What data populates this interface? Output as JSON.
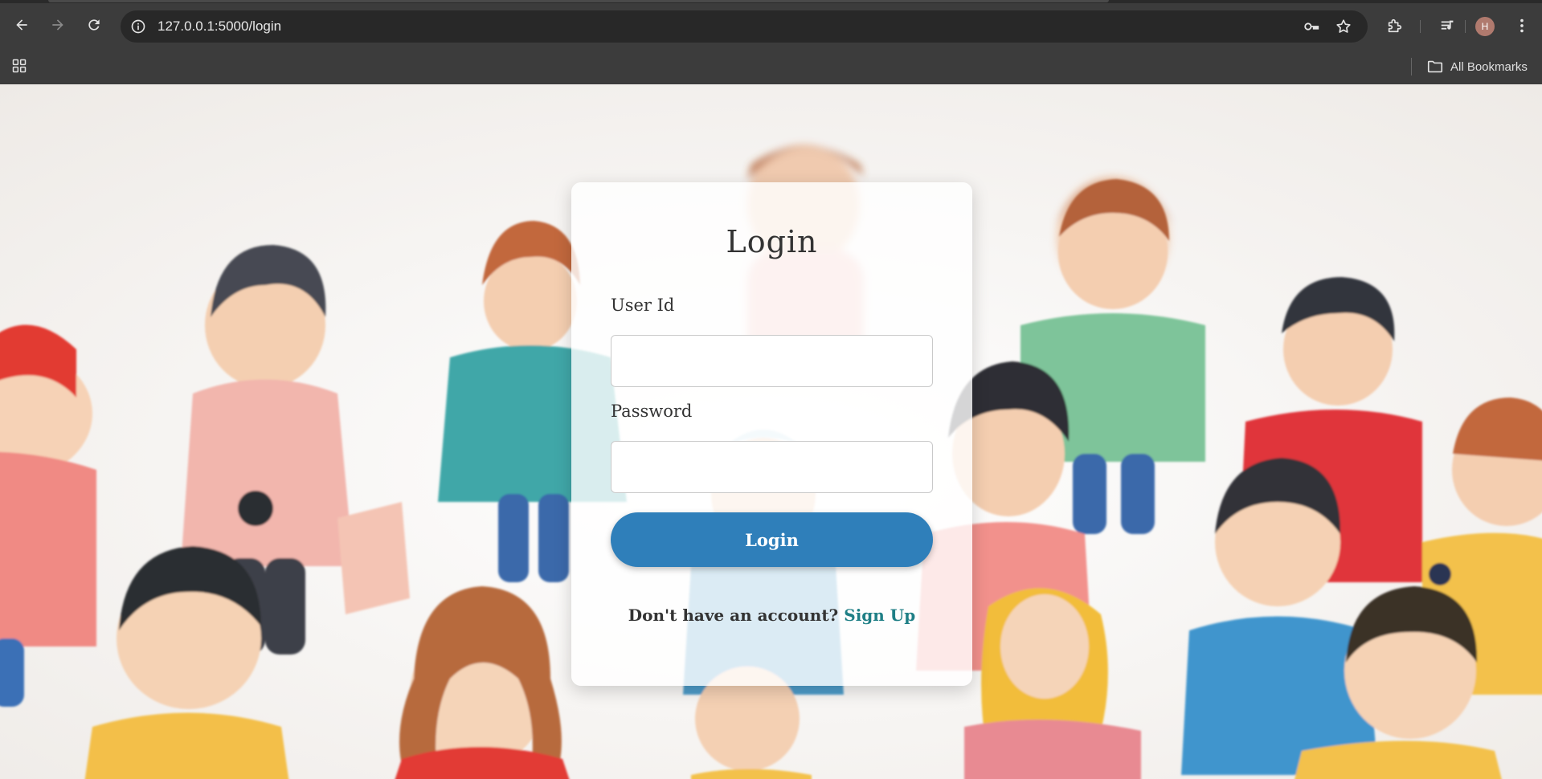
{
  "browser": {
    "url": "127.0.0.1:5000/login",
    "profile_initial": "H",
    "bookmarks_label": "All Bookmarks",
    "icons": {
      "back": "back-arrow-icon",
      "forward": "forward-arrow-icon",
      "reload": "reload-icon",
      "site_info": "site-info-icon",
      "password_key": "key-icon",
      "bookmark_star": "star-icon",
      "extensions": "puzzle-icon",
      "media": "media-queue-icon",
      "menu": "kebab-menu-icon",
      "apps": "apps-grid-icon",
      "folder": "folder-icon"
    }
  },
  "login_form": {
    "title": "Login",
    "user_id_label": "User Id",
    "user_id_value": "",
    "password_label": "Password",
    "password_value": "",
    "submit_label": "Login",
    "signup_prompt": "Don't have an account?",
    "signup_link": "Sign Up"
  },
  "colors": {
    "chrome_bg": "#3c3c3c",
    "omnibox_bg": "#282828",
    "button_blue": "#2f7fba",
    "link_teal": "#1f7f86",
    "avatar": "#b07a6e"
  }
}
